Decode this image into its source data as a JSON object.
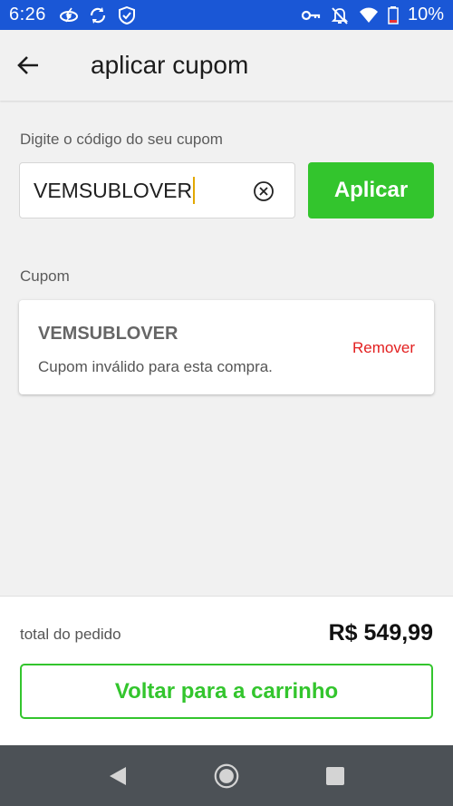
{
  "status_bar": {
    "time": "6:26",
    "battery": "10%",
    "left_icons": [
      "lightning-eye-icon",
      "sync-icon",
      "shield-check-icon"
    ],
    "right_icons": [
      "key-icon",
      "bell-off-icon",
      "wifi-icon",
      "battery-icon"
    ],
    "color": "#1a57d6"
  },
  "app_bar": {
    "title": "aplicar cupom",
    "back_icon": "arrow-left-icon"
  },
  "coupon_form": {
    "label": "Digite o código do seu cupom",
    "input_value": "VEMSUBLOVER",
    "clear_icon": "clear-circle-x-icon",
    "apply_label": "Aplicar"
  },
  "coupon_section": {
    "label": "Cupom",
    "code": "VEMSUBLOVER",
    "message": "Cupom inválido para esta compra.",
    "remove_label": "Remover"
  },
  "order": {
    "total_label": "total do pedido",
    "total_value": "R$ 549,99",
    "back_cart_label": "Voltar para a carrinho"
  },
  "colors": {
    "accent_green": "#33c52d",
    "danger_red": "#e32020",
    "nav_bar": "#4c5156"
  },
  "nav_bar": {
    "buttons": [
      "back-triangle-icon",
      "home-circle-icon",
      "recents-square-icon"
    ]
  }
}
